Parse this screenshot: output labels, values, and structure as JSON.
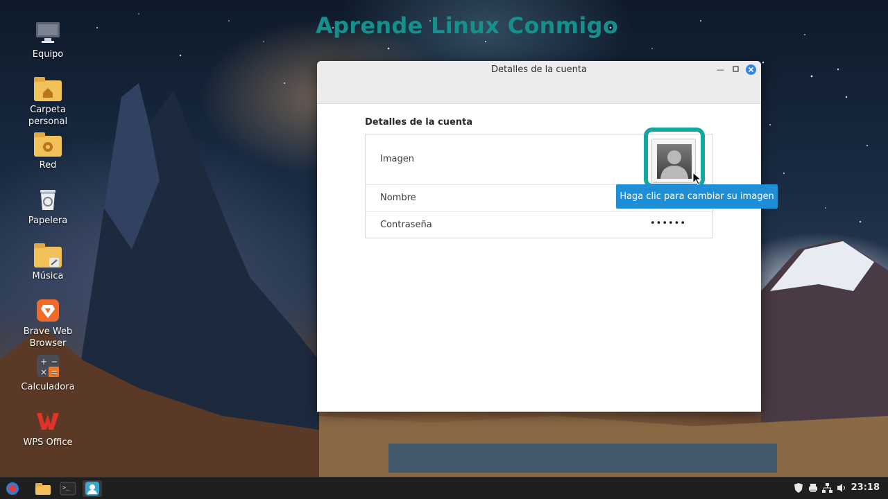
{
  "brand_title": "Aprende Linux Conmigo",
  "desktop": {
    "icons": [
      {
        "label": "Equipo"
      },
      {
        "label": "Carpeta personal"
      },
      {
        "label": "Red"
      },
      {
        "label": "Papelera"
      },
      {
        "label": "Música"
      },
      {
        "label": "Brave Web Browser"
      },
      {
        "label": "Calculadora"
      },
      {
        "label": "WPS Office"
      }
    ]
  },
  "window": {
    "title": "Detalles de la cuenta",
    "section_title": "Detalles de la cuenta",
    "rows": {
      "image_label": "Imagen",
      "name_label": "Nombre",
      "name_value": "",
      "password_label": "Contraseña",
      "password_value": "••••••"
    },
    "tooltip": "Haga clic para cambiar su imagen"
  },
  "taskbar": {
    "clock": "23:18"
  },
  "colors": {
    "accent_teal": "#13a89e",
    "tooltip_blue": "#1e8fd6",
    "close_blue": "#3584e4"
  }
}
